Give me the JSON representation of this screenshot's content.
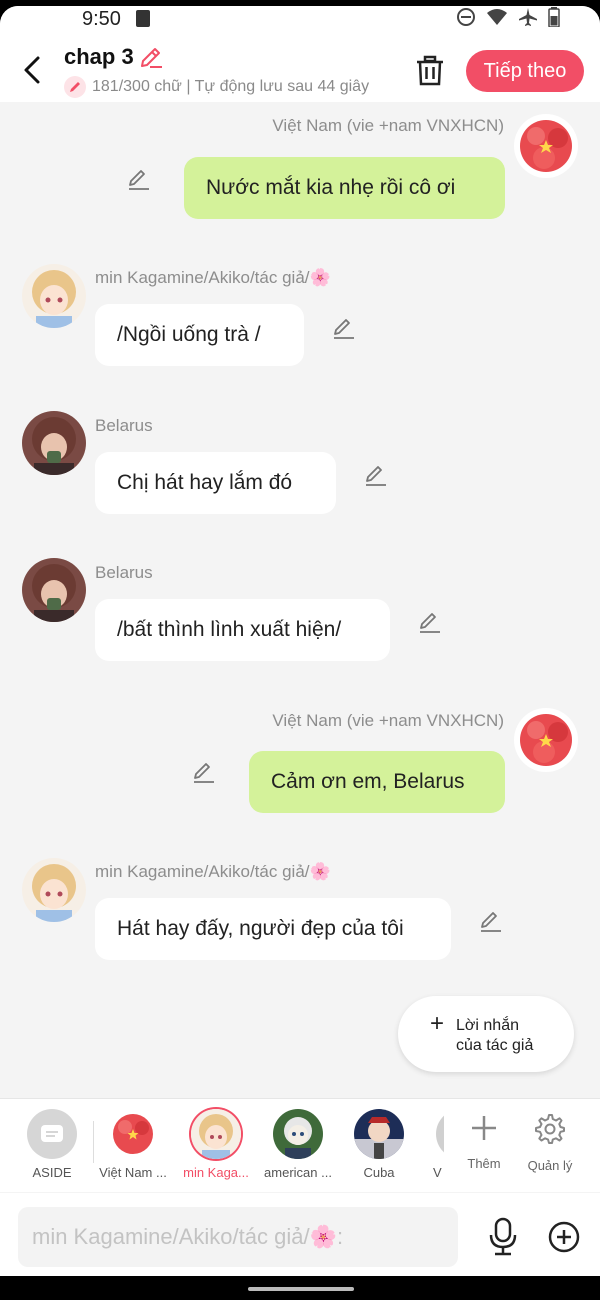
{
  "status": {
    "time": "9:50"
  },
  "header": {
    "title": "chap 3",
    "subtitle": "181/300 chữ | Tự động lưu sau 44 giây",
    "next_label": "Tiếp theo"
  },
  "messages": [
    {
      "side": "right",
      "name": "Việt Nam (vie +nam VNXHCN)",
      "text": "Nước mắt kia nhẹ rồi cô ơi",
      "avatar": "vietnam"
    },
    {
      "side": "left",
      "name": "min Kagamine/Akiko/tác giả/🌸",
      "text": "/Ngồi uống trà /",
      "avatar": "kagamine"
    },
    {
      "side": "left",
      "name": "Belarus",
      "text": "Chị hát hay lắm đó",
      "avatar": "belarus"
    },
    {
      "side": "left",
      "name": "Belarus",
      "text": "/bất thình lình xuất hiện/",
      "avatar": "belarus"
    },
    {
      "side": "right",
      "name": "Việt Nam (vie +nam VNXHCN)",
      "text": "Cảm ơn em, Belarus",
      "avatar": "vietnam"
    },
    {
      "side": "left",
      "name": "min Kagamine/Akiko/tác giả/🌸",
      "text": "Hát hay đấy, người đẹp của tôi",
      "avatar": "kagamine"
    }
  ],
  "author_message": {
    "plus": "+",
    "line1": "Lời nhắn",
    "line2": "của tác giả"
  },
  "characters": [
    {
      "label": "ASIDE"
    },
    {
      "label": "Việt Nam ..."
    },
    {
      "label": "min Kaga..."
    },
    {
      "label": "american ..."
    },
    {
      "label": "Cuba"
    },
    {
      "label": "V"
    }
  ],
  "tools": {
    "add_label": "Thêm",
    "manage_label": "Quản lý"
  },
  "input": {
    "placeholder": "min Kagamine/Akiko/tác giả/🌸:"
  },
  "colors": {
    "accent": "#f24e66",
    "my_bubble": "#d4f29a",
    "other_bubble": "#ffffff"
  }
}
